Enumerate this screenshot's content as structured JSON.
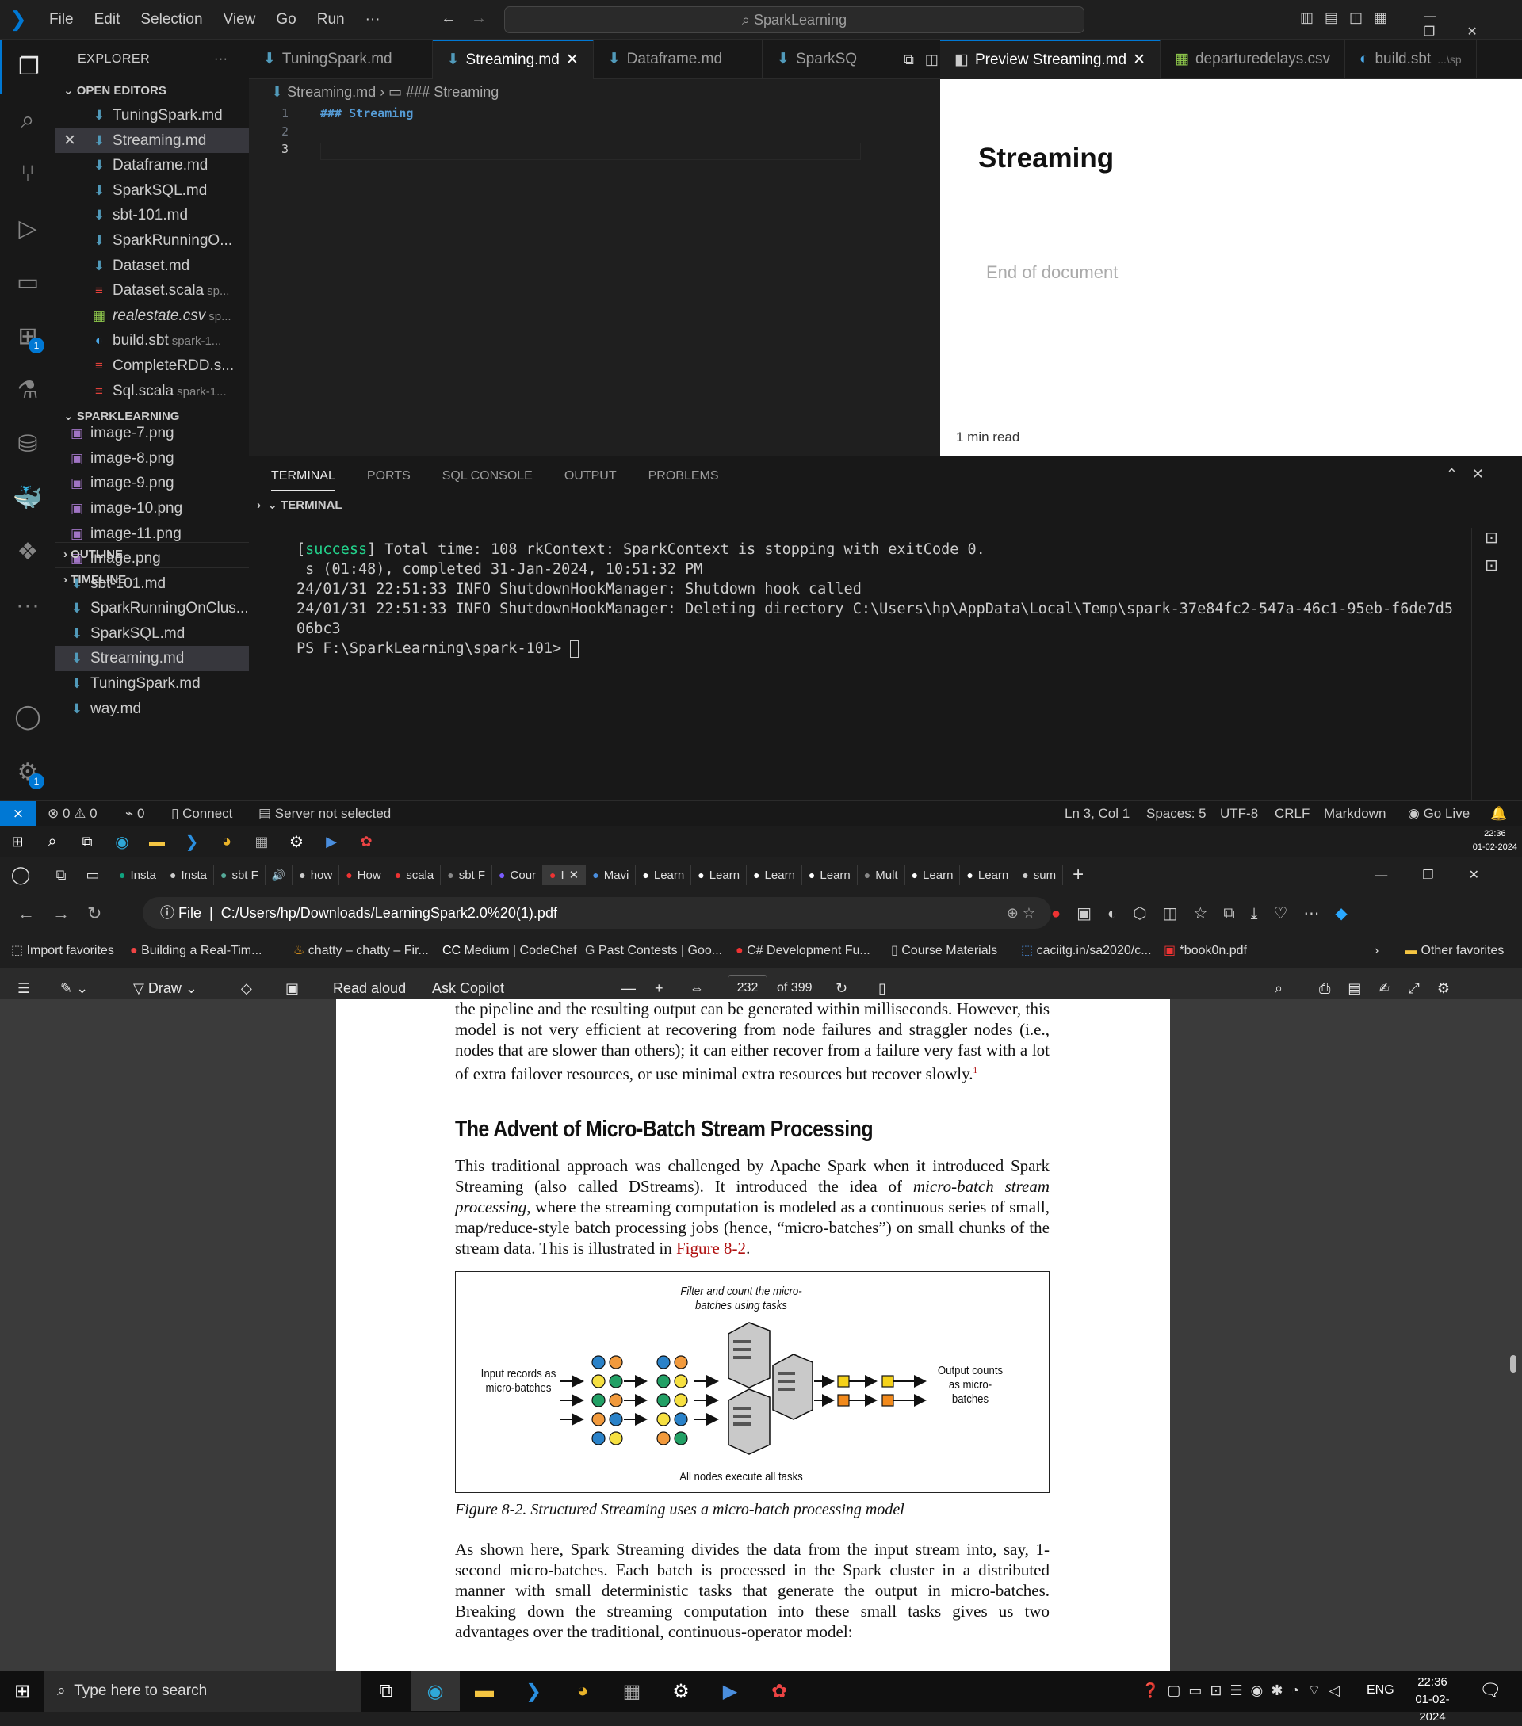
{
  "vscode": {
    "menu": [
      "File",
      "Edit",
      "Selection",
      "View",
      "Go",
      "Run",
      "···"
    ],
    "command_center": "SparkLearning",
    "explorer_title": "EXPLORER",
    "open_editors_title": "OPEN EDITORS",
    "open_editors": [
      {
        "name": "TuningSpark.md",
        "hint": "",
        "icon": "md"
      },
      {
        "name": "Streaming.md",
        "hint": "",
        "icon": "md"
      },
      {
        "name": "Dataframe.md",
        "hint": "",
        "icon": "md"
      },
      {
        "name": "SparkSQL.md",
        "hint": "",
        "icon": "md"
      },
      {
        "name": "sbt-101.md",
        "hint": "",
        "icon": "md"
      },
      {
        "name": "SparkRunningO...",
        "hint": "",
        "icon": "md"
      },
      {
        "name": "Dataset.md",
        "hint": "",
        "icon": "md"
      },
      {
        "name": "Dataset.scala",
        "hint": "sp...",
        "icon": "scala"
      },
      {
        "name": "realestate.csv",
        "hint": "sp...",
        "icon": "csv"
      },
      {
        "name": "build.sbt",
        "hint": "spark-1...",
        "icon": "sbt"
      },
      {
        "name": "CompleteRDD.s...",
        "hint": "",
        "icon": "scala"
      },
      {
        "name": "Sql.scala",
        "hint": "spark-1...",
        "icon": "scala"
      }
    ],
    "folder_title": "SPARKLEARNING",
    "folder_items": [
      {
        "name": "image-7.png",
        "icon": "img"
      },
      {
        "name": "image-8.png",
        "icon": "img"
      },
      {
        "name": "image-9.png",
        "icon": "img"
      },
      {
        "name": "image-10.png",
        "icon": "img"
      },
      {
        "name": "image-11.png",
        "icon": "img"
      },
      {
        "name": "image.png",
        "icon": "img"
      },
      {
        "name": "sbt-101.md",
        "icon": "md"
      },
      {
        "name": "SparkRunningOnClus...",
        "icon": "md"
      },
      {
        "name": "SparkSQL.md",
        "icon": "md"
      },
      {
        "name": "Streaming.md",
        "icon": "md"
      },
      {
        "name": "TuningSpark.md",
        "icon": "md"
      },
      {
        "name": "way.md",
        "icon": "md"
      }
    ],
    "outline_title": "OUTLINE",
    "timeline_title": "TIMELINE",
    "editor_tabs": [
      "TuningSpark.md",
      "Streaming.md",
      "Dataframe.md",
      "SparkSQ"
    ],
    "breadcrumb": {
      "file": "Streaming.md",
      "symbol": "### Streaming"
    },
    "code_lines": [
      "### Streaming",
      "",
      ""
    ],
    "preview_tabs": [
      "Preview Streaming.md",
      "departuredelays.csv",
      "build.sbt",
      "...\\sp"
    ],
    "preview": {
      "heading": "Streaming",
      "end": "End of document",
      "read": "1 min read"
    },
    "panel_tabs": [
      "TERMINAL",
      "PORTS",
      "SQL CONSOLE",
      "OUTPUT",
      "PROBLEMS"
    ],
    "terminal_header": "TERMINAL",
    "terminal_lines": [
      "[success] Total time: 108 rkContext: SparkContext is stopping with exitCode 0.",
      " s (01:48), completed 31-Jan-2024, 10:51:32 PM",
      "24/01/31 22:51:33 INFO ShutdownHookManager: Shutdown hook called",
      "24/01/31 22:51:33 INFO ShutdownHookManager: Deleting directory C:\\Users\\hp\\AppData\\Local\\Temp\\spark-37e84fc2-547a-46c1-95eb-f6de7d5",
      "06bc3",
      "PS F:\\SparkLearning\\spark-101> "
    ],
    "status": {
      "errors": "0",
      "warnings": "0",
      "ports": "0",
      "connect": "Connect",
      "server": "Server not selected",
      "pos": "Ln 3, Col 1",
      "spaces": "Spaces: 5",
      "enc": "UTF-8",
      "eol": "CRLF",
      "lang": "Markdown",
      "live": "Go Live"
    },
    "badge_count": "1"
  },
  "taskbar_top": {
    "time": "22:36",
    "date": "01-02-2024"
  },
  "edge": {
    "tabs": [
      "Insta",
      "Insta",
      "sbt F",
      "",
      "how",
      "How",
      "scala",
      "sbt F",
      "Cour",
      "I",
      "Mavi",
      "Learn",
      "Learn",
      "Learn",
      "Learn",
      "Mult",
      "Learn",
      "Learn",
      "sum"
    ],
    "url_prefix": "File",
    "url": "C:/Users/hp/Downloads/LearningSpark2.0%20(1).pdf",
    "favorites": [
      "Import favorites",
      "Building a Real-Tim...",
      "chatty – chatty – Fir...",
      "Medium | CodeChef",
      "Past Contests | Goo...",
      "C# Development Fu...",
      "Course Materials",
      "caciitg.in/sa2020/c...",
      "*book0n.pdf",
      "Other favorites"
    ],
    "pdf_toolbar": {
      "draw": "Draw",
      "read": "Read aloud",
      "copilot": "Ask Copilot",
      "page": "232",
      "of": "of 399"
    }
  },
  "pdf": {
    "para1": "the pipeline and the resulting output can be generated within milliseconds. However, this model is not very efficient at recovering from node failures and straggler nodes (i.e., nodes that are slower than others); it can either recover from a failure very fast with a lot of extra failover resources, or use minimal extra resources but recover slowly.",
    "footnote": "1",
    "heading": "The Advent of Micro-Batch Stream Processing",
    "para2_a": "This traditional approach was challenged by Apache Spark when it introduced Spark Streaming (also called DStreams). It introduced the idea of ",
    "para2_em": "micro-batch stream processing",
    "para2_b": ", where the streaming computation is modeled as a continuous series of small, map/reduce-style batch processing jobs (hence, “micro-batches”) on small chunks of the stream data. This is illustrated in ",
    "para2_link": "Figure 8-2",
    "para2_c": ".",
    "fig_top": "Filter and count the micro-batches using tasks",
    "fig_input": "Input records as micro-batches",
    "fig_output": "Output counts as micro-batches",
    "fig_bottom": "All nodes execute all tasks",
    "caption": "Figure 8-2. Structured Streaming uses a micro-batch processing model",
    "para3": "As shown here, Spark Streaming divides the data from the input stream into, say, 1-second micro-batches. Each batch is processed in the Spark cluster in a distributed manner with small deterministic tasks that generate the output in micro-batches. Breaking down the streaming computation into these small tasks gives us two advantages over the traditional, continuous-operator model:"
  },
  "windows": {
    "search": "Type here to search",
    "lang": "ENG",
    "time": "22:36",
    "date": "01-02-2024"
  },
  "colors": {
    "accent": "#0078d4",
    "md": "#519aba",
    "vsbg": "#1f1f1f"
  }
}
